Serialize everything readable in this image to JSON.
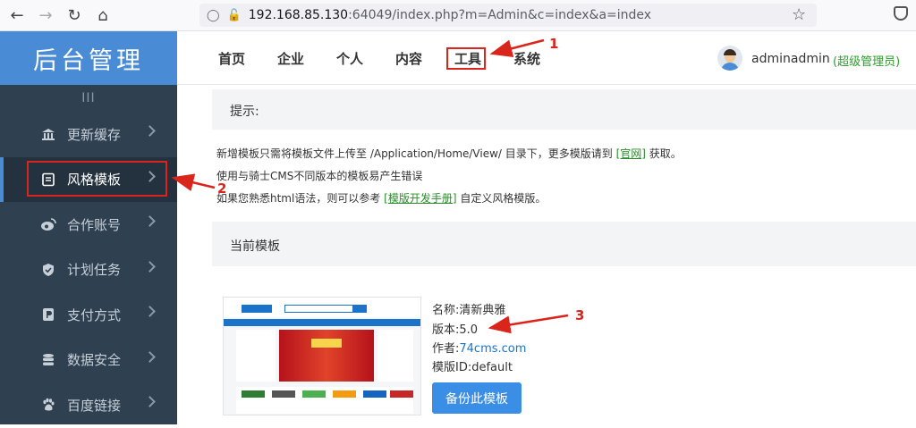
{
  "browser": {
    "url_host": "192.168.85.130",
    "url_rest": ":64049/index.php?m=Admin&c=index&a=index"
  },
  "sidebar": {
    "logo": "后台管理",
    "collapse_glyph": "III",
    "items": [
      {
        "label": "更新缓存",
        "icon": "bank-icon"
      },
      {
        "label": "风格模板",
        "icon": "template-icon",
        "active": true
      },
      {
        "label": "合作账号",
        "icon": "weibo-icon"
      },
      {
        "label": "计划任务",
        "icon": "shield-icon"
      },
      {
        "label": "支付方式",
        "icon": "payment-icon"
      },
      {
        "label": "数据安全",
        "icon": "database-icon"
      },
      {
        "label": "百度链接",
        "icon": "paw-icon"
      }
    ]
  },
  "topnav": {
    "tabs": [
      "首页",
      "企业",
      "个人",
      "内容",
      "工具",
      "系统"
    ],
    "active_tab": "工具",
    "username": "adminadmin",
    "role": "(超级管理员)"
  },
  "tips": {
    "heading": "提示:",
    "line1_pre": "新增模板只需将模板文件上传至 /Application/Home/View/ 目录下，更多模版请到 ",
    "line1_link": "[官网]",
    "line1_post": " 获取。",
    "line2": "使用与骑士CMS不同版本的模板易产生错误",
    "line3_pre": "如果您熟悉html语法，则可以参考 ",
    "line3_link": "[模版开发手册]",
    "line3_post": " 自定义风格模版。"
  },
  "current": {
    "heading": "当前模板",
    "name_label": "名称:",
    "name": "清新典雅",
    "version_label": "版本:",
    "version": "5.0",
    "author_label": "作者:",
    "author": "74cms.com",
    "id_label": "模版ID:",
    "id": "default",
    "backup_button": "备份此模板"
  },
  "annotations": [
    "1",
    "2",
    "3"
  ],
  "colors": {
    "sidebar_bg": "#2f4050",
    "logo_bg": "#4a8bd6",
    "highlight_red": "#d9251c",
    "button_blue": "#3b8ee6",
    "role_green": "#2aa02a"
  }
}
